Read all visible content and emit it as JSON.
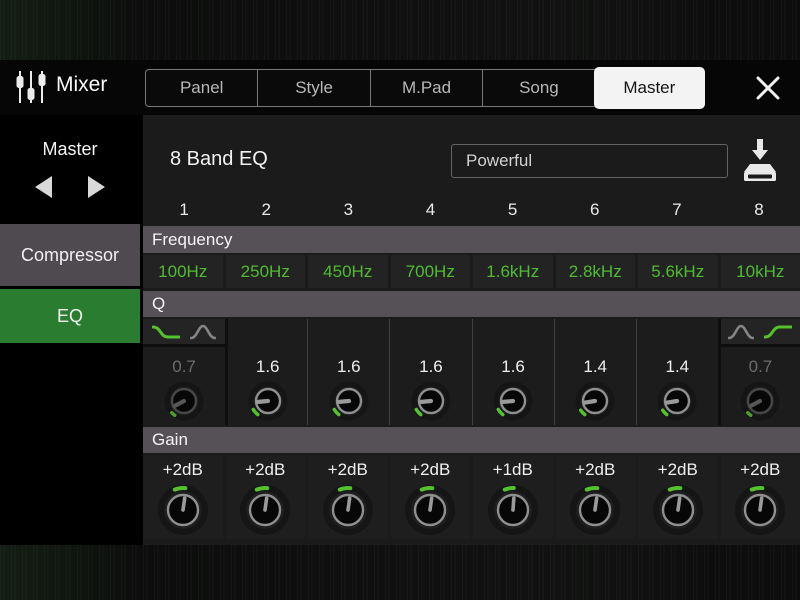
{
  "header": {
    "title": "Mixer",
    "tabs": [
      {
        "label": "Panel",
        "active": false
      },
      {
        "label": "Style",
        "active": false
      },
      {
        "label": "M.Pad",
        "active": false
      },
      {
        "label": "Song",
        "active": false
      },
      {
        "label": "Master",
        "active": true
      }
    ]
  },
  "sidebar": {
    "title": "Master",
    "items": [
      {
        "label": "Compressor",
        "active": false
      },
      {
        "label": "EQ",
        "active": true
      }
    ]
  },
  "eq": {
    "title": "8 Band EQ",
    "preset": "Powerful",
    "sections": {
      "frequency": "Frequency",
      "q": "Q",
      "gain": "Gain"
    },
    "bands": [
      {
        "number": "1",
        "freq": "100Hz",
        "q": {
          "value": "0.7",
          "dim": true,
          "type": "low-shelf",
          "pointer": -118,
          "arc": [
            -147,
            -134
          ]
        },
        "gain": {
          "value": "+2dB",
          "pointer": 8,
          "arc": [
            -22,
            6
          ]
        }
      },
      {
        "number": "2",
        "freq": "250Hz",
        "q": {
          "value": "1.6",
          "dim": false,
          "pointer": -95,
          "arc": [
            -143,
            -120
          ]
        },
        "gain": {
          "value": "+2dB",
          "pointer": 8,
          "arc": [
            -22,
            6
          ]
        }
      },
      {
        "number": "3",
        "freq": "450Hz",
        "q": {
          "value": "1.6",
          "dim": false,
          "pointer": -95,
          "arc": [
            -143,
            -120
          ]
        },
        "gain": {
          "value": "+2dB",
          "pointer": 8,
          "arc": [
            -22,
            6
          ]
        }
      },
      {
        "number": "4",
        "freq": "700Hz",
        "q": {
          "value": "1.6",
          "dim": false,
          "pointer": -95,
          "arc": [
            -143,
            -120
          ]
        },
        "gain": {
          "value": "+2dB",
          "pointer": 8,
          "arc": [
            -22,
            6
          ]
        }
      },
      {
        "number": "5",
        "freq": "1.6kHz",
        "q": {
          "value": "1.6",
          "dim": false,
          "pointer": -95,
          "arc": [
            -143,
            -120
          ]
        },
        "gain": {
          "value": "+1dB",
          "pointer": 4,
          "arc": [
            -22,
            2
          ]
        }
      },
      {
        "number": "6",
        "freq": "2.8kHz",
        "q": {
          "value": "1.4",
          "dim": false,
          "pointer": -99,
          "arc": [
            -143,
            -123
          ]
        },
        "gain": {
          "value": "+2dB",
          "pointer": 8,
          "arc": [
            -22,
            6
          ]
        }
      },
      {
        "number": "7",
        "freq": "5.6kHz",
        "q": {
          "value": "1.4",
          "dim": false,
          "pointer": -99,
          "arc": [
            -143,
            -123
          ]
        },
        "gain": {
          "value": "+2dB",
          "pointer": 8,
          "arc": [
            -22,
            6
          ]
        }
      },
      {
        "number": "8",
        "freq": "10kHz",
        "q": {
          "value": "0.7",
          "dim": true,
          "type": "high-shelf",
          "pointer": -118,
          "arc": [
            -147,
            -134
          ]
        },
        "gain": {
          "value": "+2dB",
          "pointer": 8,
          "arc": [
            -22,
            6
          ]
        }
      }
    ]
  },
  "colors": {
    "accent_green": "#53c22d",
    "freq_text_green": "#4fbc30",
    "eq_item_bg": "#2a7c31",
    "section_bar_bg": "#555156",
    "compressor_item_bg": "#4e4a4f",
    "active_tab_bg": "#f3f3f3"
  }
}
